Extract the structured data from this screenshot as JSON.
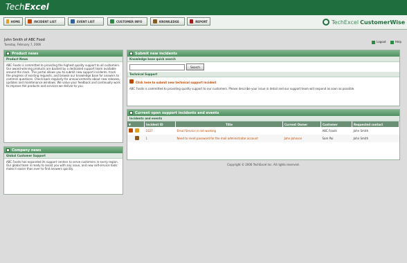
{
  "header": {
    "logo_part1": "Tech",
    "logo_part2": "Excel"
  },
  "toolbar": {
    "buttons": [
      {
        "label": "HOME",
        "icon": "home-icon",
        "color": "#e0a020"
      },
      {
        "label": "INCIDENT LIST",
        "icon": "list-icon",
        "color": "#c04a00"
      },
      {
        "label": "EVENT LIST",
        "icon": "event-icon",
        "color": "#3060a0"
      },
      {
        "label": "CUSTOMER INFO",
        "icon": "customer-icon",
        "color": "#2f8a45"
      },
      {
        "label": "KNOWLEDGE",
        "icon": "book-icon",
        "color": "#8a5a20"
      },
      {
        "label": "REPORT",
        "icon": "report-icon",
        "color": "#a02020"
      }
    ],
    "brand_light": "TechExcel",
    "brand_bold": "CustomerWise"
  },
  "user": {
    "name": "John Smith of ABC Food",
    "date": "Tuesday, February 7, 2006"
  },
  "top_links": {
    "logout": "Logout",
    "help": "Help"
  },
  "product_news": {
    "title": "Product news",
    "subtitle": "Product News",
    "body": "ABC Foods is committed to providing the highest quality support to all customers. Our award-winning products are backed by a dedicated support team available around the clock. This portal allows you to submit new support incidents, track the progress of existing requests, and browse our knowledge base for answers to common questions. Check back regularly for announcements about new releases, updates and maintenance windows. We value your feedback and continually work to improve the products and services we deliver to you."
  },
  "company_news": {
    "title": "Company news",
    "subtitle": "Global Customer Support",
    "body": "ABC Foods has expanded its support centers to serve customers in every region. Our global team is ready to assist you with any issue, and new self-service tools make it easier than ever to find answers quickly."
  },
  "submit": {
    "title": "Submit new incidents",
    "search_label": "Knowledge base quick search",
    "search_button": "Search",
    "tech_label": "Technical Support",
    "link": "Click here to submit new technical support incident",
    "desc": "ABC Foods is committed to providing quality support to our customers. Please describe your issue in detail and our support team will respond as soon as possible."
  },
  "current": {
    "title": "Current open support incidents and events",
    "subtitle": "Incidents and events",
    "columns": [
      "",
      "Incident ID",
      "Title",
      "Current Owner",
      "Customer",
      "Requested contact"
    ],
    "rows": [
      {
        "id": "1027",
        "title": "Email Service is not working",
        "owner": "",
        "customer": "ABC Foods",
        "contact": "John Smith"
      },
      {
        "id": "1",
        "title": "Need to reset password for the mail administrator account",
        "owner": "John Johnson",
        "customer": "Sam Pai",
        "contact": "John Smith"
      }
    ]
  },
  "footer": "Copyright © 2006 TechExcel Inc. All rights reserved."
}
